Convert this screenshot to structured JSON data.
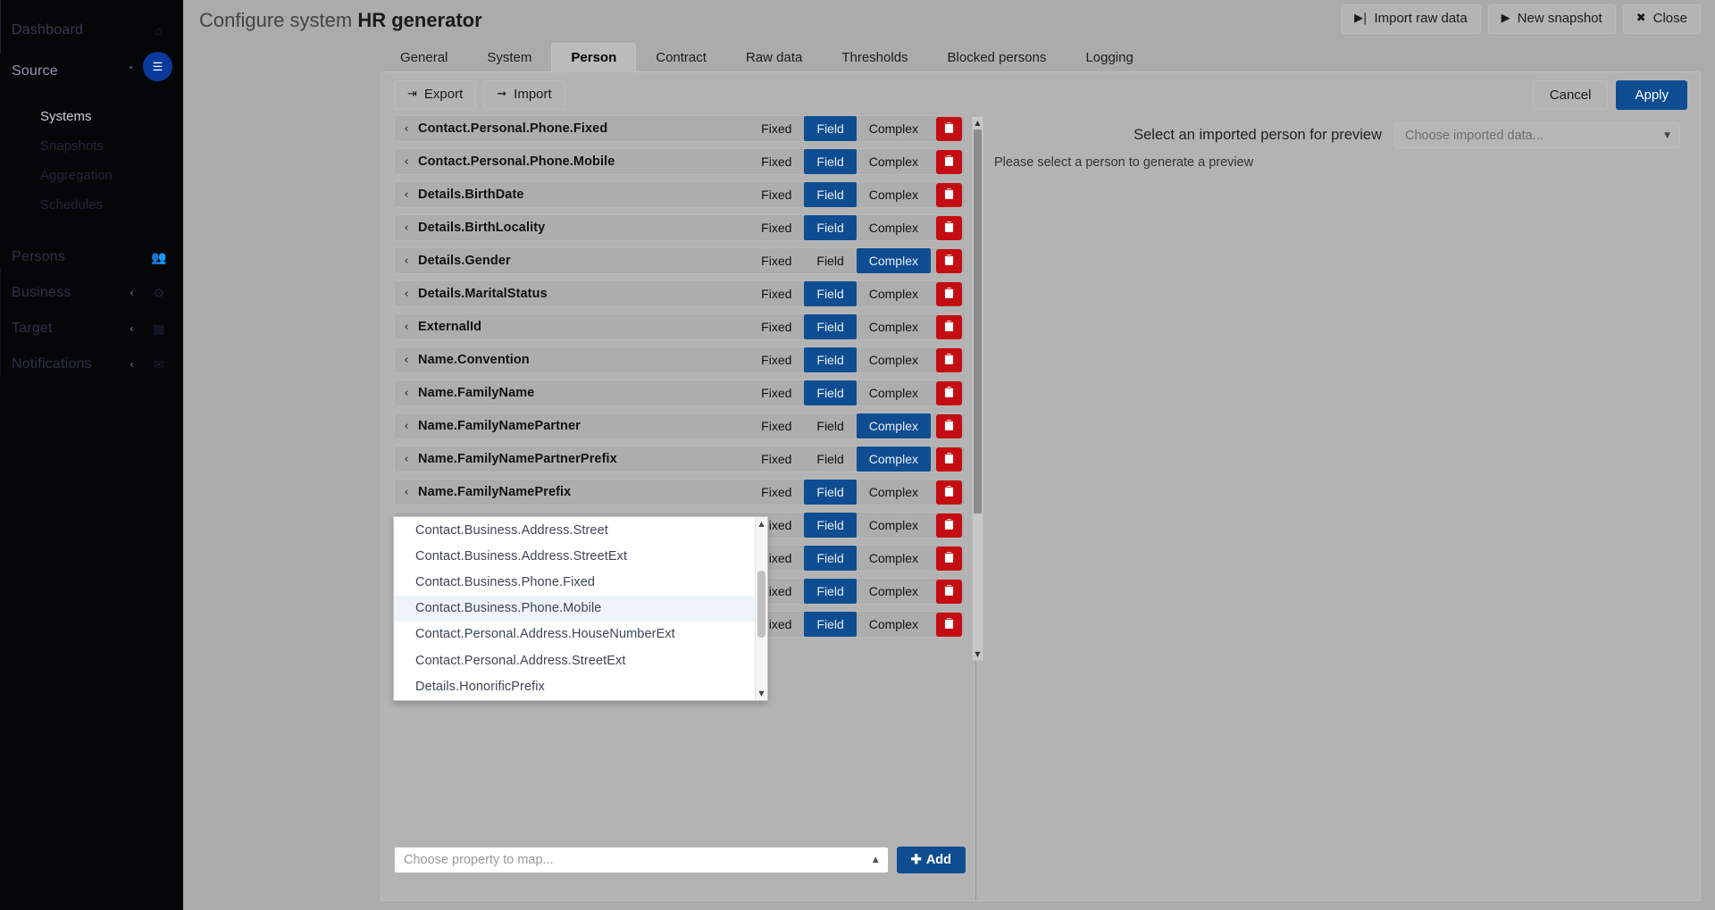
{
  "sidebar": {
    "items": [
      {
        "label": "Dashboard",
        "icon": "home-icon",
        "level": 0,
        "chevron": null,
        "bright": false
      },
      {
        "label": "Source",
        "icon": "layers-icon",
        "level": 0,
        "chevron": "v",
        "bright": true
      }
    ],
    "sub_items": [
      {
        "label": "Systems",
        "active": true
      },
      {
        "label": "Snapshots",
        "active": false
      },
      {
        "label": "Aggregation",
        "active": false
      },
      {
        "label": "Schedules",
        "active": false
      }
    ],
    "lower_items": [
      {
        "label": "Persons",
        "icon": "users-icon",
        "chevron": null
      },
      {
        "label": "Business",
        "icon": "briefcase-icon",
        "chevron": "<"
      },
      {
        "label": "Target",
        "icon": "grid-icon",
        "chevron": "<"
      },
      {
        "label": "Notifications",
        "icon": "mail-icon",
        "chevron": "<"
      }
    ]
  },
  "header": {
    "title_prefix": "Configure system",
    "title_bold": "HR generator",
    "actions": [
      {
        "label": "Import raw data",
        "icon": "import-step-icon",
        "glyph": "▶|"
      },
      {
        "label": "New snapshot",
        "icon": "play-icon",
        "glyph": "▶"
      },
      {
        "label": "Close",
        "icon": "close-icon",
        "glyph": "✖"
      }
    ]
  },
  "tabs": [
    {
      "label": "General",
      "active": false
    },
    {
      "label": "System",
      "active": false
    },
    {
      "label": "Person",
      "active": true
    },
    {
      "label": "Contract",
      "active": false
    },
    {
      "label": "Raw data",
      "active": false
    },
    {
      "label": "Thresholds",
      "active": false
    },
    {
      "label": "Blocked persons",
      "active": false
    },
    {
      "label": "Logging",
      "active": false
    }
  ],
  "toolbar": {
    "export_label": "Export",
    "export_glyph": "↷",
    "import_label": "Import",
    "import_glyph": "➡",
    "cancel_label": "Cancel",
    "apply_label": "Apply"
  },
  "segments": {
    "fixed": "Fixed",
    "field": "Field",
    "complex": "Complex"
  },
  "rows": [
    {
      "name": "Contact.Personal.Phone.Fixed",
      "mode": "field"
    },
    {
      "name": "Contact.Personal.Phone.Mobile",
      "mode": "field"
    },
    {
      "name": "Details.BirthDate",
      "mode": "field"
    },
    {
      "name": "Details.BirthLocality",
      "mode": "field"
    },
    {
      "name": "Details.Gender",
      "mode": "complex"
    },
    {
      "name": "Details.MaritalStatus",
      "mode": "field"
    },
    {
      "name": "ExternalId",
      "mode": "field"
    },
    {
      "name": "Name.Convention",
      "mode": "field"
    },
    {
      "name": "Name.FamilyName",
      "mode": "field"
    },
    {
      "name": "Name.FamilyNamePartner",
      "mode": "complex"
    },
    {
      "name": "Name.FamilyNamePartnerPrefix",
      "mode": "complex"
    },
    {
      "name": "Name.FamilyNamePrefix",
      "mode": "field"
    },
    {
      "name": "",
      "mode": "field"
    },
    {
      "name": "",
      "mode": "field"
    },
    {
      "name": "",
      "mode": "field"
    },
    {
      "name": "",
      "mode": "field"
    }
  ],
  "dropdown": {
    "items": [
      {
        "label": "Contact.Business.Address.Street",
        "highlighted": false
      },
      {
        "label": "Contact.Business.Address.StreetExt",
        "highlighted": false
      },
      {
        "label": "Contact.Business.Phone.Fixed",
        "highlighted": false
      },
      {
        "label": "Contact.Business.Phone.Mobile",
        "highlighted": true
      },
      {
        "label": "Contact.Personal.Address.HouseNumberExt",
        "highlighted": false
      },
      {
        "label": "Contact.Personal.Address.StreetExt",
        "highlighted": false
      },
      {
        "label": "Details.HonorificPrefix",
        "highlighted": false
      }
    ]
  },
  "add_bar": {
    "combo_placeholder": "Choose property to map...",
    "add_label": "Add",
    "add_glyph": "✚"
  },
  "preview": {
    "label": "Select an imported person for preview",
    "select_placeholder": "Choose imported data...",
    "message": "Please select a person to generate a preview"
  },
  "colors": {
    "accent_blue": "#0f4d92",
    "danger_red": "#c40d12",
    "sidebar_bg": "#050608",
    "content_bg": "#aaabab"
  }
}
